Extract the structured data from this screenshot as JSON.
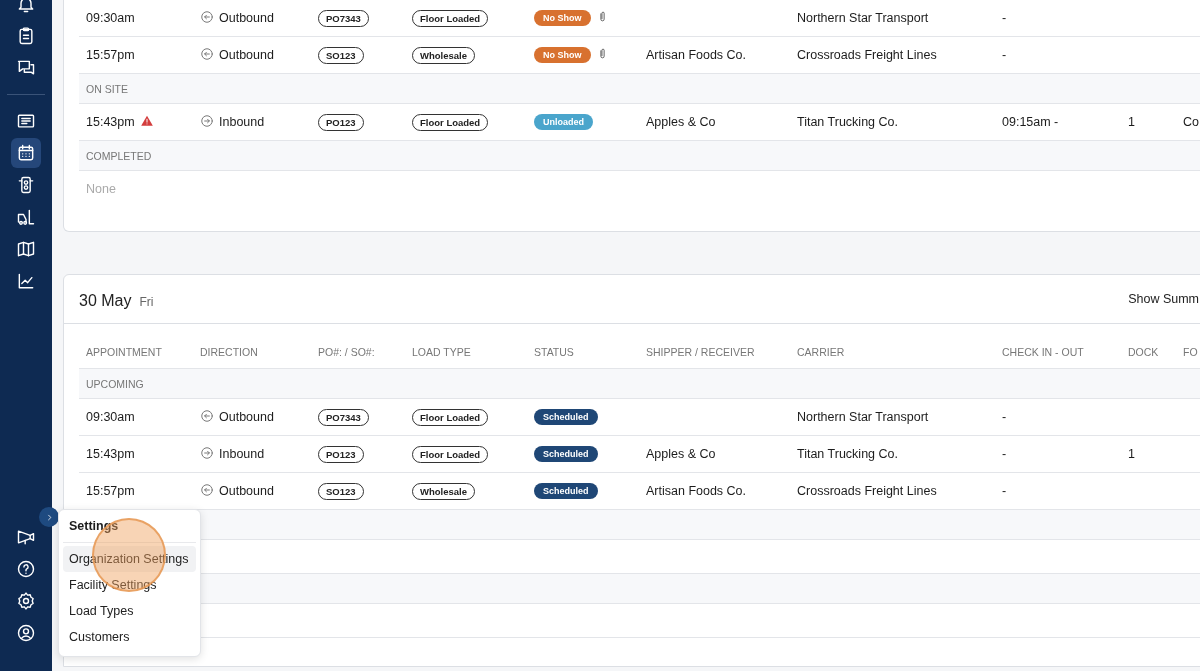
{
  "sidebar": {
    "items": [
      {
        "selected": false
      },
      {
        "selected": false
      },
      {
        "selected": false
      },
      {
        "selected": false
      },
      {
        "selected": true
      },
      {
        "selected": false
      },
      {
        "selected": false
      },
      {
        "selected": false
      },
      {
        "selected": false
      }
    ],
    "bottom_items": [
      {
        "selected": false
      },
      {
        "selected": false
      },
      {
        "selected": false
      },
      {
        "selected": false
      }
    ]
  },
  "day_top": {
    "groups": [
      {
        "kind": "list",
        "rows": [
          {
            "time": "09:30am",
            "warning": false,
            "direction": {
              "kind": "outbound",
              "label": "Outbound"
            },
            "po": "PO7343",
            "load_type": "Floor Loaded",
            "status": {
              "label": "No Show",
              "color": "#d8712f"
            },
            "attachment": true,
            "shipper": "",
            "carrier": "Northern Star Transport",
            "check": "-",
            "dock": "",
            "column_10": ""
          },
          {
            "time": "15:57pm",
            "warning": false,
            "direction": {
              "kind": "outbound",
              "label": "Outbound"
            },
            "po": "SO123",
            "load_type": "Wholesale",
            "status": {
              "label": "No Show",
              "color": "#d8712f"
            },
            "attachment": true,
            "shipper": "Artisan Foods Co.",
            "carrier": "Crossroads Freight Lines",
            "check": "-",
            "dock": "",
            "column_10": ""
          }
        ]
      },
      {
        "kind": "list",
        "label": "ON SITE",
        "rows": [
          {
            "time": "15:43pm",
            "warning": true,
            "direction": {
              "kind": "inbound",
              "label": "Inbound"
            },
            "po": "PO123",
            "load_type": "Floor Loaded",
            "status": {
              "label": "Unloaded",
              "color": "#4aa5cc"
            },
            "attachment": false,
            "shipper": "Apples & Co",
            "carrier": "Titan Trucking Co.",
            "check": "09:15am -",
            "dock": "1",
            "column_10": "Co"
          }
        ]
      },
      {
        "kind": "list",
        "label": "COMPLETED",
        "empty_text": "None"
      }
    ]
  },
  "day": {
    "title": "30 May",
    "weekday": "Fri",
    "action": "Show Summ",
    "columns": [
      "APPOINTMENT",
      "DIRECTION",
      "PO#: / SO#:",
      "LOAD TYPE",
      "STATUS",
      "SHIPPER / RECEIVER",
      "CARRIER",
      "CHECK IN - OUT",
      "DOCK",
      "FO"
    ],
    "groups": [
      {
        "kind": "list",
        "label": "UPCOMING",
        "rows": [
          {
            "time": "09:30am",
            "warning": false,
            "direction": {
              "kind": "outbound",
              "label": "Outbound"
            },
            "po": "PO7343",
            "load_type": "Floor Loaded",
            "status": {
              "label": "Scheduled",
              "color": "#1f4776"
            },
            "attachment": false,
            "shipper": "",
            "carrier": "Northern Star Transport",
            "check": "-",
            "dock": "",
            "column_10": ""
          },
          {
            "time": "15:43pm",
            "warning": false,
            "direction": {
              "kind": "inbound",
              "label": "Inbound"
            },
            "po": "PO123",
            "load_type": "Floor Loaded",
            "status": {
              "label": "Scheduled",
              "color": "#1f4776"
            },
            "attachment": false,
            "shipper": "Apples & Co",
            "carrier": "Titan Trucking Co.",
            "check": "-",
            "dock": "1",
            "column_10": ""
          },
          {
            "time": "15:57pm",
            "warning": false,
            "direction": {
              "kind": "outbound",
              "label": "Outbound"
            },
            "po": "SO123",
            "load_type": "Wholesale",
            "status": {
              "label": "Scheduled",
              "color": "#1f4776"
            },
            "attachment": false,
            "shipper": "Artisan Foods Co.",
            "carrier": "Crossroads Freight Lines",
            "check": "-",
            "dock": "",
            "column_10": ""
          }
        ]
      },
      {
        "kind": "covered"
      },
      {
        "kind": "covered"
      }
    ]
  },
  "menu": {
    "title": "Settings",
    "items": [
      {
        "label": "Organization Settings",
        "selected": true
      },
      {
        "label": "Facility Settings",
        "selected": false
      },
      {
        "label": "Load Types",
        "selected": false
      },
      {
        "label": "Customers",
        "selected": false
      }
    ]
  }
}
